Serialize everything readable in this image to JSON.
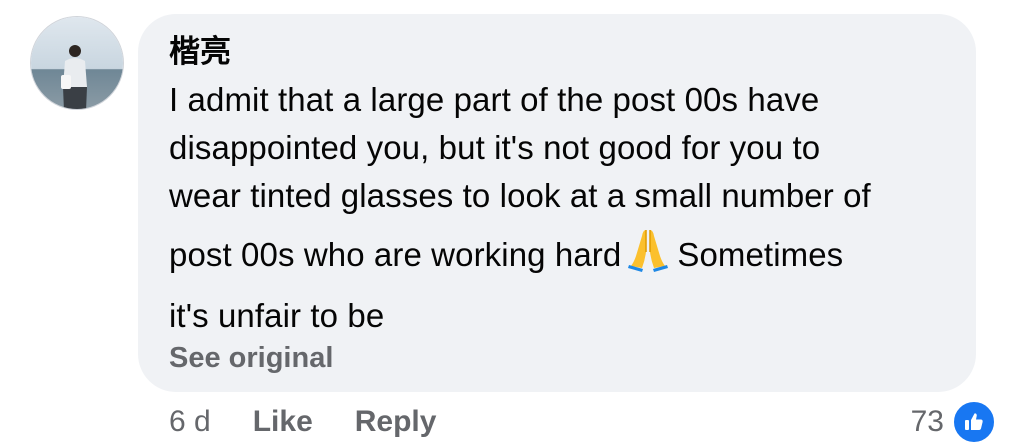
{
  "comment": {
    "author": "楷亮",
    "text_lines": [
      "I admit that a large part of the post 00s have",
      "disappointed you, but it's not good for you to",
      "wear tinted glasses to look at a small number of",
      "post 00s who are working hard",
      "Sometimes",
      "it's unfair to be"
    ],
    "see_original_label": "See original"
  },
  "actions": {
    "timestamp": "6 d",
    "like_label": "Like",
    "reply_label": "Reply"
  },
  "reactions": {
    "count": "73",
    "icon": "thumbs-up-icon"
  },
  "colors": {
    "bubble_bg": "#f0f2f5",
    "muted_text": "#65676b",
    "primary_text": "#050505",
    "like_blue": "#1877f2"
  }
}
